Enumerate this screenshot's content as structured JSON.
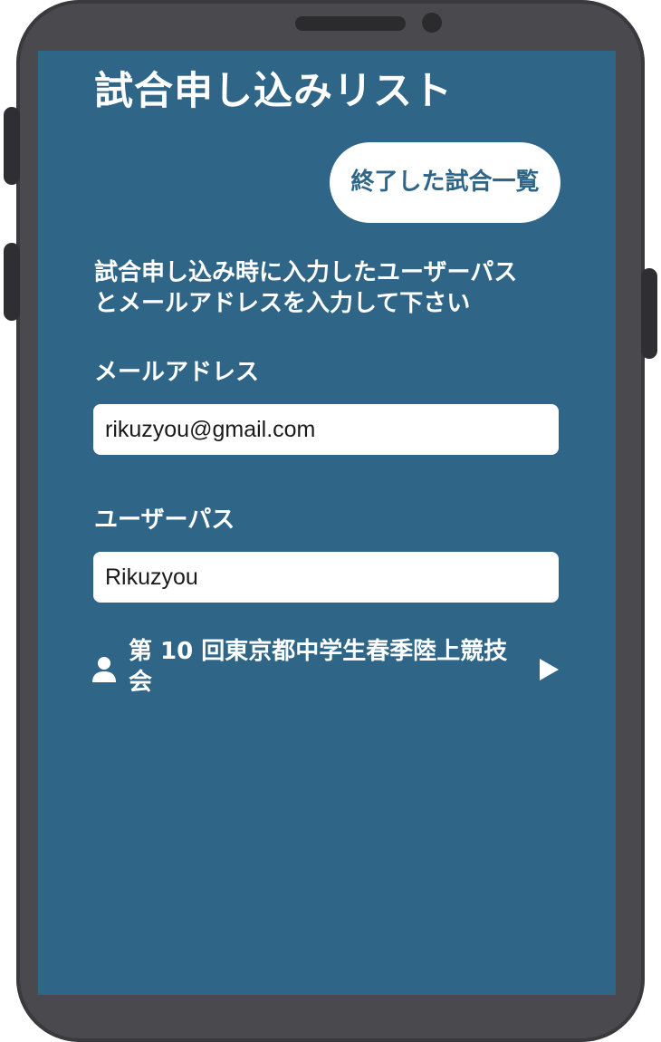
{
  "screen": {
    "title": "試合申し込みリスト",
    "finished_button_label": "終了した試合一覧",
    "instruction_line1": "試合申し込み時に入力したユーザーパス",
    "instruction_line2": "とメールアドレスを入力して下さい",
    "email": {
      "label": "メールアドレス",
      "value": "rikuzyou@gmail.com"
    },
    "user_pass": {
      "label": "ユーザーパス",
      "value": "Rikuzyou"
    },
    "tournament": {
      "name_line1": "第 10 回東京都中学生春季陸上競技",
      "name_line2": "会",
      "icon": "person-icon",
      "action_icon": "play-icon"
    }
  },
  "colors": {
    "screen_background": "#2f6688",
    "device_frame": "#4a4a4e",
    "text": "#ffffff",
    "button_background": "#ffffff",
    "button_text": "#2f6688"
  }
}
